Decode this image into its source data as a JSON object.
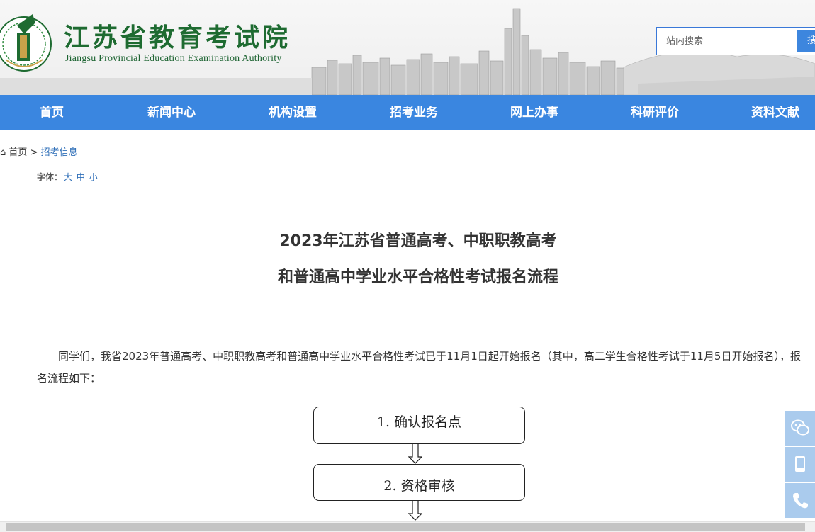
{
  "header": {
    "title": "江苏省教育考试院",
    "subtitle": "Jiangsu Provincial Education Examination Authority",
    "logo_icon": "jsea-emblem-icon",
    "search_placeholder": "站内搜索",
    "search_button": "搜"
  },
  "nav": {
    "items": [
      {
        "label": "首页"
      },
      {
        "label": "新闻中心"
      },
      {
        "label": "机构设置"
      },
      {
        "label": "招考业务"
      },
      {
        "label": "网上办事"
      },
      {
        "label": "科研评价"
      },
      {
        "label": "资料文献"
      }
    ]
  },
  "breadcrumb": {
    "home": "首页",
    "separator": ">",
    "current": "招考信息"
  },
  "font_control": {
    "label": "字体",
    "colon": "：",
    "large": "大",
    "medium": "中",
    "small": "小"
  },
  "article": {
    "title_line1": "2023年江苏省普通高考、中职职教高考",
    "title_line2": "和普通高中学业水平合格性考试报名流程",
    "body": "同学们，我省2023年普通高考、中职职教高考和普通高中学业水平合格性考试已于11月1日起开始报名（其中，高二学生合格性考试于11月5日开始报名），报名流程如下："
  },
  "flowchart": {
    "steps": [
      "1. 确认报名点",
      "2. 资格审核"
    ]
  },
  "side_tools": {
    "icons": [
      "wechat-icon",
      "mobile-icon",
      "phone-icon"
    ]
  },
  "colors": {
    "nav_blue": "#3a86e0",
    "title_green": "#1e6b31",
    "link_blue": "#2f6fb8",
    "side_blue": "#aacbed"
  }
}
